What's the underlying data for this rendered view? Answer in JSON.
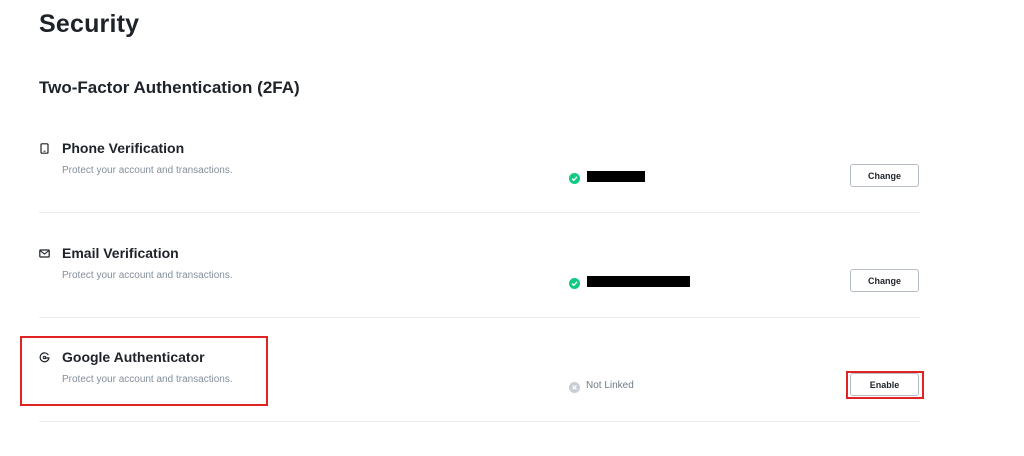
{
  "page": {
    "title": "Security"
  },
  "section": {
    "title": "Two-Factor Authentication (2FA)"
  },
  "rows": [
    {
      "title": "Phone Verification",
      "description": "Protect your account and transactions.",
      "icon": "phone-icon",
      "status": {
        "icon": "check-circle-icon",
        "color": "#0ecb81",
        "text": "",
        "redacted": true
      },
      "button": "Change"
    },
    {
      "title": "Email Verification",
      "description": "Protect your account and transactions.",
      "icon": "email-icon",
      "status": {
        "icon": "check-circle-icon",
        "color": "#0ecb81",
        "text": "",
        "redacted": true
      },
      "button": "Change"
    },
    {
      "title": "Google Authenticator",
      "description": "Protect your account and transactions.",
      "icon": "google-authenticator-icon",
      "status": {
        "icon": "x-circle-icon",
        "color": "#b7bdc6",
        "text": "Not Linked",
        "redacted": false
      },
      "button": "Enable"
    }
  ],
  "colors": {
    "text": "#1e2329",
    "muted": "#848e9c",
    "success": "#0ecb81",
    "annotation": "#e02424"
  }
}
